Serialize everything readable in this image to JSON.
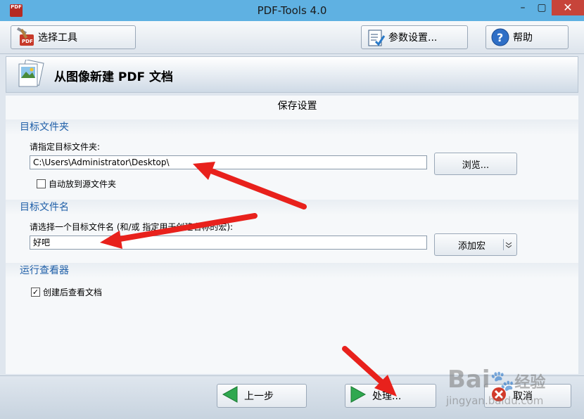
{
  "window": {
    "title": "PDF-Tools 4.0",
    "app_icon_text": "PDF",
    "min_glyph": "–",
    "max_glyph": "▢",
    "close_glyph": "✕"
  },
  "toolbar": {
    "select_tool_label": "选择工具",
    "params_label": "参数设置...",
    "help_label": "帮助"
  },
  "header": {
    "title": "从图像新建 PDF 文档"
  },
  "content": {
    "section_title": "保存设置",
    "target_folder": {
      "title": "目标文件夹",
      "prompt": "请指定目标文件夹:",
      "value": "C:\\Users\\Administrator\\Desktop\\",
      "browse_label": "浏览...",
      "auto_source_label": "自动放到源文件夹",
      "auto_source_checked": false
    },
    "target_filename": {
      "title": "目标文件名",
      "prompt": "请选择一个目标文件名 (和/或 指定用于创建名称的宏):",
      "value": "好吧",
      "add_macro_label": "添加宏"
    },
    "viewer": {
      "title": "运行查看器",
      "view_after_label": "创建后查看文档",
      "view_after_checked": true
    }
  },
  "footer": {
    "back_label": "上一步",
    "process_label": "处理...",
    "cancel_label": "取消"
  },
  "watermark": {
    "brand": "Bai",
    "brand_cn": "经验",
    "url": "jingyan.baidu.com"
  },
  "colors": {
    "titlebar": "#5fb1e2",
    "group_title": "#1f5fa8",
    "close_button": "#c7443a",
    "annotation_arrow": "#e8211c",
    "nav_arrow_green": "#2fa84f"
  }
}
